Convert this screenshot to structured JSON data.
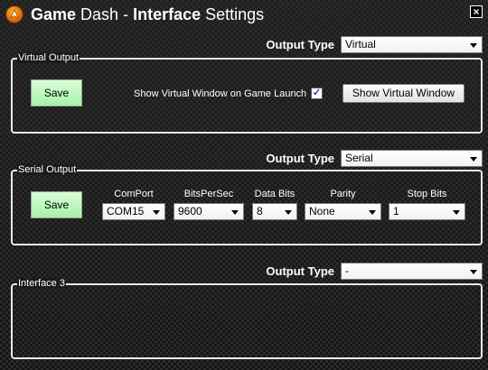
{
  "window": {
    "title_part1": "Game",
    "title_part2": "Dash -",
    "title_part3": "Interface",
    "title_part4": "Settings",
    "close_glyph": "×"
  },
  "colors": {
    "accent_icon": "#e06a00",
    "save_button_bg": "#b8f5b8"
  },
  "sections": [
    {
      "output_type_label": "Output Type",
      "output_type_value": "Virtual",
      "group_title": "Virtual Output",
      "save_label": "Save",
      "checkbox_label": "Show Virtual Window on Game Launch",
      "checkbox_checked": true,
      "checkbox_glyph": "✓",
      "show_button_label": "Show Virtual Window"
    },
    {
      "output_type_label": "Output Type",
      "output_type_value": "Serial",
      "group_title": "Serial Output",
      "save_label": "Save",
      "fields": [
        {
          "header": "ComPort",
          "value": "COM15"
        },
        {
          "header": "BitsPerSec",
          "value": "9600"
        },
        {
          "header": "Data Bits",
          "value": "8"
        },
        {
          "header": "Parity",
          "value": "None"
        },
        {
          "header": "Stop Bits",
          "value": "1"
        }
      ]
    },
    {
      "output_type_label": "Output Type",
      "output_type_value": "-",
      "group_title": "Interface 3"
    }
  ]
}
